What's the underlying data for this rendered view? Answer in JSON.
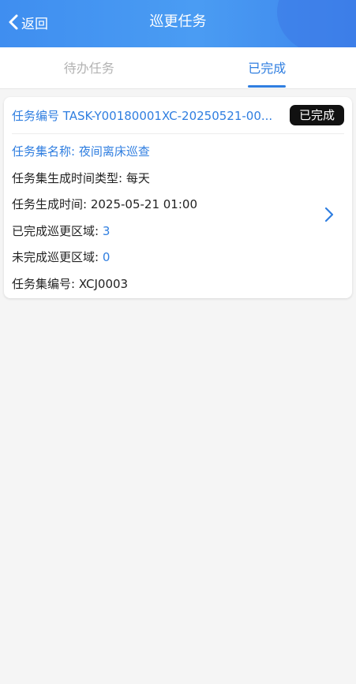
{
  "header": {
    "back_label": "返回",
    "title": "巡更任务"
  },
  "tabs": [
    {
      "label": "待办任务",
      "active": false
    },
    {
      "label": "已完成",
      "active": true
    }
  ],
  "card": {
    "task_no": "任务编号 TASK-Y00180001XC-20250521-00...",
    "status": "已完成",
    "set_name": "任务集名称: 夜间离床巡查",
    "gen_type": "任务集生成时间类型: 每天",
    "gen_time": "任务生成时间: 2025-05-21 01:00",
    "done_label": "已完成巡更区域: ",
    "done_value": "3",
    "undone_label": "未完成巡更区域: ",
    "undone_value": "0",
    "set_no": "任务集编号: XCJ0003"
  },
  "colors": {
    "accent": "#2f7ee0",
    "header": "#4a9cf3",
    "badge": "#111111"
  }
}
